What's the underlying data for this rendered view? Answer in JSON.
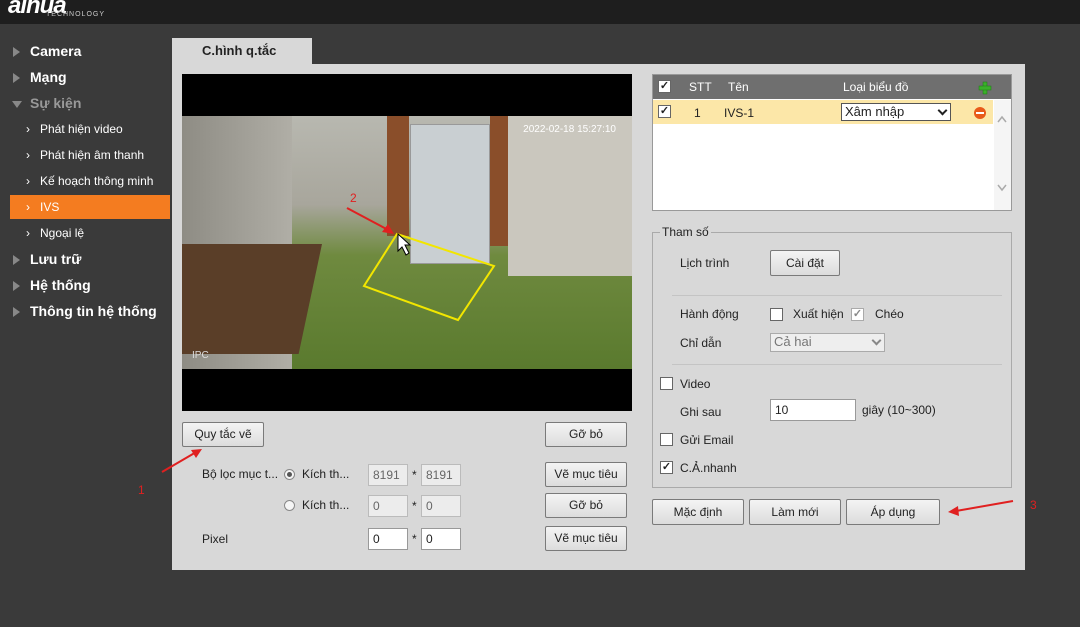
{
  "logo": {
    "brand": "alhua",
    "sub": "TECHNOLOGY"
  },
  "sidebar": {
    "items": [
      {
        "label": "Camera"
      },
      {
        "label": "Mạng"
      },
      {
        "label": "Sự kiện"
      },
      {
        "label": "Phát hiện video"
      },
      {
        "label": "Phát hiện âm thanh"
      },
      {
        "label": "Kế hoạch thông minh"
      },
      {
        "label": "IVS"
      },
      {
        "label": "Ngoại lệ"
      },
      {
        "label": "Lưu trữ"
      },
      {
        "label": "Hệ thống"
      },
      {
        "label": "Thông tin hệ thống"
      }
    ]
  },
  "tab": {
    "label": "C.hình q.tắc"
  },
  "video": {
    "timestamp": "2022-02-18 15:27:10",
    "overlay_label": "IPC",
    "marker": "2"
  },
  "left_panel": {
    "draw_rule_button": "Quy tắc vẽ",
    "remove_button_1": "Gỡ bỏ",
    "filter_label": "Bộ lọc mục t...",
    "size_label_1": "Kích th...",
    "size_label_2": "Kích th...",
    "max_w": "8191",
    "max_h": "8191",
    "min_w": "0",
    "min_h": "0",
    "draw_target_button_1": "Vẽ mục tiêu",
    "remove_button_2": "Gỡ bỏ",
    "pixel_label": "Pixel",
    "pixel_w": "0",
    "pixel_h": "0",
    "draw_target_button_2": "Vẽ mục tiêu",
    "times": "*"
  },
  "rule_table": {
    "headers": {
      "stt": "STT",
      "name": "Tên",
      "type": "Loại biểu đồ"
    },
    "rows": [
      {
        "stt": "1",
        "name": "IVS-1",
        "type": "Xâm nhập",
        "checked": true
      }
    ]
  },
  "params": {
    "legend": "Tham số",
    "schedule_label": "Lịch trình",
    "settings_button": "Cài đặt",
    "action_label": "Hành động",
    "appear_label": "Xuất hiện",
    "appear_checked": false,
    "cross_label": "Chéo",
    "cross_checked": true,
    "direction_label": "Chỉ dẫn",
    "direction_value": "Cả hai",
    "video_label": "Video",
    "video_checked": false,
    "post_record_label": "Ghi sau",
    "post_record_value": "10",
    "post_record_unit": "giây (10~300)",
    "email_label": "Gửi Email",
    "email_checked": false,
    "snapshot_label": "C.Ả.nhanh",
    "snapshot_checked": true
  },
  "footer_buttons": {
    "default": "Mặc định",
    "refresh": "Làm mới",
    "apply": "Áp dụng"
  },
  "annotations": {
    "n1": "1",
    "n3": "3"
  },
  "colors": {
    "accent": "#f47c20",
    "annotation": "#e02020",
    "rule_box": "#f2e600"
  }
}
